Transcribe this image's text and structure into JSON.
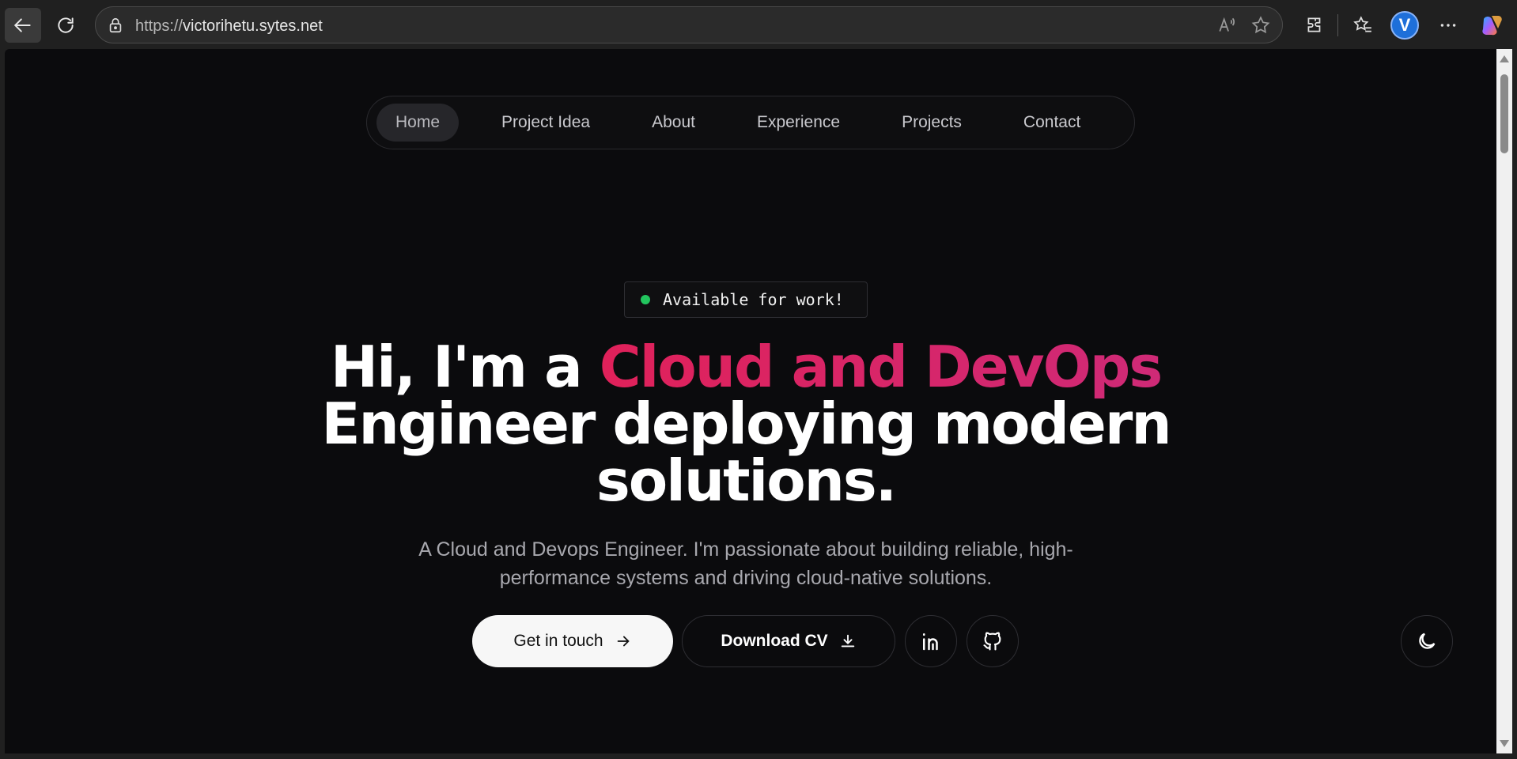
{
  "browser": {
    "url_protocol": "https://",
    "url_host": "victorihetu.sytes.net",
    "profile_initial": "V",
    "icons": [
      "back-arrow-icon",
      "reload-icon",
      "lock-icon",
      "read-aloud-icon",
      "favorite-star-icon",
      "extensions-icon",
      "favorites-icon",
      "more-icon",
      "copilot-icon"
    ]
  },
  "nav": {
    "items": [
      {
        "label": "Home"
      },
      {
        "label": "Project Idea"
      },
      {
        "label": "About"
      },
      {
        "label": "Experience"
      },
      {
        "label": "Projects"
      },
      {
        "label": "Contact"
      }
    ],
    "active": "Home"
  },
  "badge": {
    "text": "Available for work!",
    "status_color": "#22c55e"
  },
  "hero": {
    "title_line1_prefix": "Hi, I'm a ",
    "title_accent": "Cloud and DevOps",
    "title_line2": "Engineer deploying modern",
    "title_line3": "solutions.",
    "subtitle": "A Cloud and Devops Engineer. I'm passionate about building reliable, high-performance systems and driving cloud-native solutions.",
    "accent_color": "#d6245f"
  },
  "actions": {
    "primary_label": "Get in touch",
    "secondary_label": "Download CV"
  },
  "colors": {
    "page_bg": "#0b0b0d",
    "text": "#ffffff",
    "muted": "#a8a8ae"
  }
}
